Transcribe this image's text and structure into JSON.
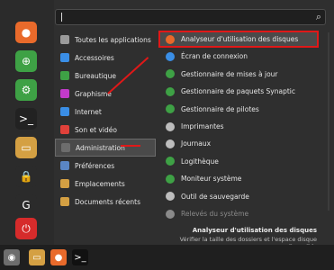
{
  "search": {
    "placeholder": ""
  },
  "sidebar": {
    "buttons": [
      {
        "name": "firefox",
        "color": "#e96a2b",
        "glyph": "●"
      },
      {
        "name": "software-manager",
        "color": "#3ea145",
        "glyph": "⊕"
      },
      {
        "name": "system-settings",
        "color": "#3ea145",
        "glyph": "⚙"
      },
      {
        "name": "terminal",
        "color": "#222222",
        "glyph": ">_"
      },
      {
        "name": "files",
        "color": "#d4a043",
        "glyph": "▭"
      },
      {
        "name": "lock",
        "color": "#2b2b2b",
        "glyph": "🔒"
      },
      {
        "name": "logout",
        "color": "#2b2b2b",
        "glyph": "G"
      },
      {
        "name": "power",
        "color": "#d62b2b",
        "glyph": "⏻"
      }
    ]
  },
  "categories": [
    {
      "label": "Toutes les applications",
      "color": "#9a9a9a"
    },
    {
      "label": "Accessoires",
      "color": "#3a8ee6"
    },
    {
      "label": "Bureautique",
      "color": "#3ea145"
    },
    {
      "label": "Graphisme",
      "color": "#c33acb"
    },
    {
      "label": "Internet",
      "color": "#3a8ee6"
    },
    {
      "label": "Son et vidéo",
      "color": "#e0413a"
    },
    {
      "label": "Administration",
      "color": "#6d6d6d"
    },
    {
      "label": "Préférences",
      "color": "#5a86c5"
    },
    {
      "label": "Emplacements",
      "color": "#d4a043"
    },
    {
      "label": "Documents récents",
      "color": "#d4a043"
    }
  ],
  "apps": [
    {
      "label": "Analyseur d'utilisation des disques",
      "color": "#e8682a"
    },
    {
      "label": "Écran de connexion",
      "color": "#3a8ee6"
    },
    {
      "label": "Gestionnaire de mises à jour",
      "color": "#3ea145"
    },
    {
      "label": "Gestionnaire de paquets Synaptic",
      "color": "#3ea145"
    },
    {
      "label": "Gestionnaire de pilotes",
      "color": "#3ea145"
    },
    {
      "label": "Imprimantes",
      "color": "#bdbdbd"
    },
    {
      "label": "Journaux",
      "color": "#bdbdbd"
    },
    {
      "label": "Logithèque",
      "color": "#3ea145"
    },
    {
      "label": "Moniteur système",
      "color": "#3ea145"
    },
    {
      "label": "Outil de sauvegarde",
      "color": "#bdbdbd"
    },
    {
      "label": "Relevés du système",
      "color": "#8a8a8a"
    }
  ],
  "description": {
    "title": "Analyseur d'utilisation des disques",
    "text": "Vérifier la taille des dossiers et l'espace disque disponible"
  },
  "accent": "#e01818",
  "taskbar": {
    "items": [
      {
        "name": "mint-menu",
        "color": "#6d6d6d",
        "glyph": "◉"
      },
      {
        "name": "files",
        "color": "#d4a043",
        "glyph": "▭"
      },
      {
        "name": "firefox",
        "color": "#e96a2b",
        "glyph": "●"
      },
      {
        "name": "terminal",
        "color": "#111111",
        "glyph": ">_"
      }
    ]
  }
}
